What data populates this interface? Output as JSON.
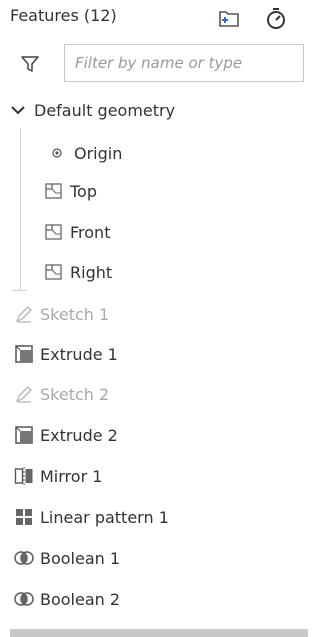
{
  "header": {
    "title": "Features (12)",
    "icons": [
      "add-folder-icon",
      "rollback-timer-icon"
    ]
  },
  "filter": {
    "icon": "filter-icon",
    "placeholder": "Filter by name or type"
  },
  "tree": {
    "group": {
      "label": "Default geometry",
      "expanded": true,
      "icon": "chevron-down-icon"
    },
    "group_children": [
      {
        "label": "Origin",
        "icon": "origin-point-icon"
      },
      {
        "label": "Top",
        "icon": "plane-icon"
      },
      {
        "label": "Front",
        "icon": "plane-icon"
      },
      {
        "label": "Right",
        "icon": "plane-icon"
      }
    ],
    "features": [
      {
        "label": "Sketch 1",
        "icon": "sketch-pencil-icon",
        "suppressed_look": true
      },
      {
        "label": "Extrude 1",
        "icon": "extrude-icon",
        "suppressed_look": false
      },
      {
        "label": "Sketch 2",
        "icon": "sketch-pencil-icon",
        "suppressed_look": true
      },
      {
        "label": "Extrude 2",
        "icon": "extrude-icon",
        "suppressed_look": false
      },
      {
        "label": "Mirror 1",
        "icon": "mirror-icon",
        "suppressed_look": false
      },
      {
        "label": "Linear pattern 1",
        "icon": "linear-pattern-icon",
        "suppressed_look": false
      },
      {
        "label": "Boolean 1",
        "icon": "boolean-icon",
        "suppressed_look": false
      },
      {
        "label": "Boolean 2",
        "icon": "boolean-icon",
        "suppressed_look": false
      }
    ]
  },
  "colors": {
    "text": "#333333",
    "dim_text": "#a8a8a8",
    "icon_dark": "#555555",
    "accent_blue": "#2a6fc9"
  }
}
